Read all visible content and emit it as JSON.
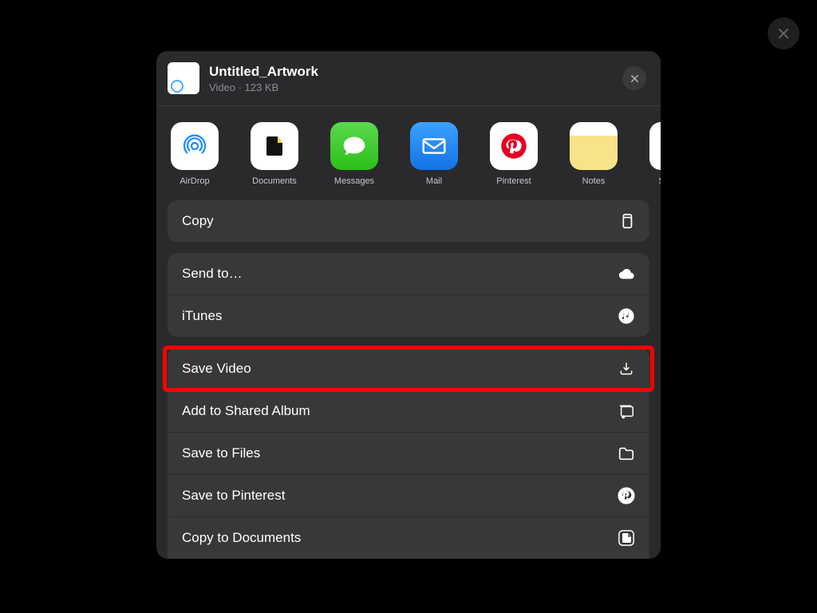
{
  "page": {
    "close_icon": "close"
  },
  "file": {
    "title": "Untitled_Artwork",
    "subtitle": "Video · 123 KB"
  },
  "apps": [
    {
      "label": "AirDrop",
      "icon": "airdrop"
    },
    {
      "label": "Documents",
      "icon": "documents"
    },
    {
      "label": "Messages",
      "icon": "messages"
    },
    {
      "label": "Mail",
      "icon": "mail"
    },
    {
      "label": "Pinterest",
      "icon": "pinterest"
    },
    {
      "label": "Notes",
      "icon": "notes"
    },
    {
      "label": "S",
      "icon": "shortcut"
    }
  ],
  "actions": {
    "copy": "Copy",
    "send_to": "Send to…",
    "itunes": "iTunes",
    "save_video": "Save Video",
    "add_shared": "Add to Shared Album",
    "save_files": "Save to Files",
    "save_pinterest": "Save to Pinterest",
    "copy_documents": "Copy to Documents"
  },
  "highlight": {
    "target": "save_video"
  }
}
